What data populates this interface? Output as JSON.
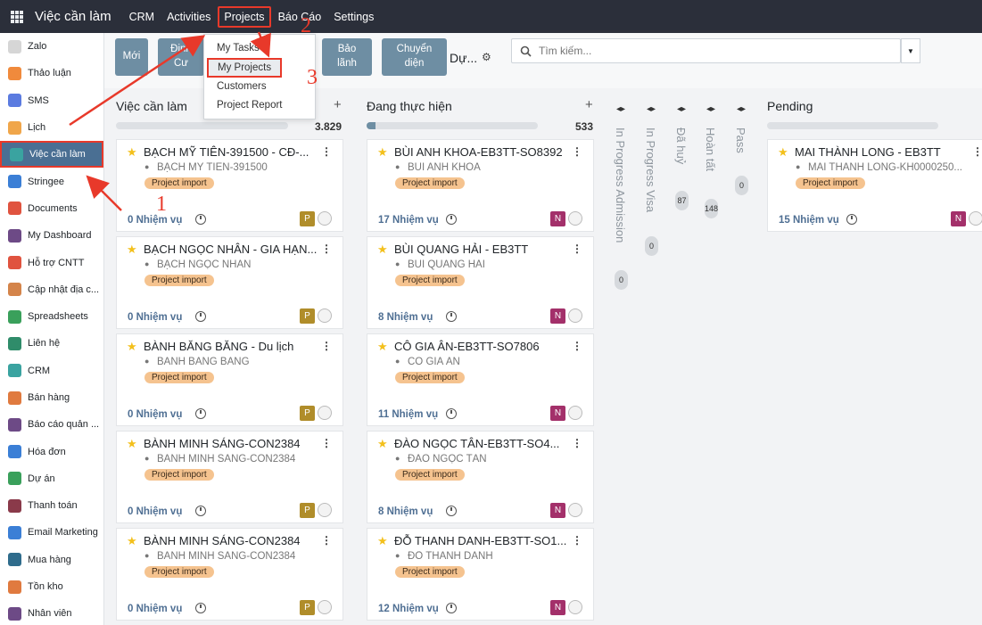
{
  "topbar": {
    "app_title": "Việc cần làm",
    "menu": [
      "CRM",
      "Activities",
      "Projects",
      "Báo Cáo",
      "Settings"
    ],
    "active_menu": "Projects"
  },
  "sidebar": {
    "items": [
      {
        "label": "Zalo",
        "icon": "zalo-icon",
        "color": "#d6d6d6"
      },
      {
        "label": "Thảo luận",
        "icon": "discuss-icon",
        "color": "#f08a3c"
      },
      {
        "label": "SMS",
        "icon": "sms-icon",
        "color": "#5b7be0"
      },
      {
        "label": "Lịch",
        "icon": "calendar-icon",
        "color": "#f0a64a"
      },
      {
        "label": "Việc cần làm",
        "icon": "todo-icon",
        "color": "#3aa3a0"
      },
      {
        "label": "Stringee",
        "icon": "stringee-icon",
        "color": "#3b7fd6"
      },
      {
        "label": "Documents",
        "icon": "documents-icon",
        "color": "#e0533f"
      },
      {
        "label": "My Dashboard",
        "icon": "dashboard-icon",
        "color": "#6d4a86"
      },
      {
        "label": "Hỗ trợ CNTT",
        "icon": "helpdesk-icon",
        "color": "#e0533f"
      },
      {
        "label": "Cập nhật địa c...",
        "icon": "map-icon",
        "color": "#d4844a"
      },
      {
        "label": "Spreadsheets",
        "icon": "spreadsheet-icon",
        "color": "#3aa05b"
      },
      {
        "label": "Liên hệ",
        "icon": "contacts-icon",
        "color": "#2f8c6a"
      },
      {
        "label": "CRM",
        "icon": "crm-icon",
        "color": "#3aa3a0"
      },
      {
        "label": "Bán hàng",
        "icon": "sales-icon",
        "color": "#e07a3f"
      },
      {
        "label": "Báo cáo quản ...",
        "icon": "report-icon",
        "color": "#6d4a86"
      },
      {
        "label": "Hóa đơn",
        "icon": "invoice-icon",
        "color": "#3b7fd6"
      },
      {
        "label": "Dự án",
        "icon": "project-icon",
        "color": "#3aa05b"
      },
      {
        "label": "Thanh toán",
        "icon": "payment-icon",
        "color": "#8a3a4a"
      },
      {
        "label": "Email Marketing",
        "icon": "email-icon",
        "color": "#3b7fd6"
      },
      {
        "label": "Mua hàng",
        "icon": "purchase-icon",
        "color": "#2f6c8c"
      },
      {
        "label": "Tồn kho",
        "icon": "inventory-icon",
        "color": "#e07a3f"
      },
      {
        "label": "Nhân viên",
        "icon": "employees-icon",
        "color": "#6d4a86"
      }
    ],
    "active_index": 4
  },
  "controls": {
    "new_button": "Mới",
    "dinh_cu_line1": "Định",
    "dinh_cu_line2": "Cư",
    "bao_lanh_line1": "Bảo",
    "bao_lanh_line2": "lãnh",
    "chuyen_dien_line1": "Chuyển",
    "chuyen_dien_line2": "diện",
    "view_label": "Dự...",
    "search_placeholder": "Tìm kiếm..."
  },
  "dropdown": {
    "items": [
      "My Tasks",
      "My Projects",
      "Customers",
      "Project Report"
    ],
    "selected": "My Projects"
  },
  "annotations": [
    "1",
    "2",
    "3"
  ],
  "colors": {
    "accent": "#6e8ea3",
    "highlight": "#e8392a",
    "tag_bg": "#f5c38f",
    "avatar_p": "#b08d2a",
    "avatar_n": "#a3306a"
  },
  "columns": [
    {
      "title": "Việc cần làm",
      "count": "3.829",
      "progress": 0.0,
      "cards": [
        {
          "title": "BẠCH MỸ TIÊN-391500 - CĐ-...",
          "customer": "BẠCH MỸ TIÊN-391500",
          "tag": "Project import",
          "tasks": "0 Nhiệm vụ",
          "avatar": "P"
        },
        {
          "title": "BẠCH NGỌC NHÂN - GIA HẠN...",
          "customer": "BẠCH NGỌC NHÂN",
          "tag": "Project import",
          "tasks": "0 Nhiệm vụ",
          "avatar": "P"
        },
        {
          "title": "BÀNH BĂNG BĂNG - Du lịch",
          "customer": "BÀNH BĂNG BĂNG",
          "tag": "Project import",
          "tasks": "0 Nhiệm vụ",
          "avatar": "P"
        },
        {
          "title": "BÀNH MINH SÁNG-CON2384",
          "customer": "BÀNH MINH SÁNG-CON2384",
          "tag": "Project import",
          "tasks": "0 Nhiệm vụ",
          "avatar": "P"
        },
        {
          "title": "BÀNH MINH SÁNG-CON2384",
          "customer": "BÀNH MINH SÁNG-CON2384",
          "tag": "Project import",
          "tasks": "0 Nhiệm vụ",
          "avatar": "P"
        }
      ]
    },
    {
      "title": "Đang thực hiện",
      "count": "533",
      "progress": 0.05,
      "cards": [
        {
          "title": "BÙI ANH KHOA-EB3TT-SO8392",
          "customer": "BÙI ANH KHOA",
          "tag": "Project import",
          "tasks": "17 Nhiệm vụ",
          "avatar": "N"
        },
        {
          "title": "BÙI QUANG HẢI - EB3TT",
          "customer": "BÙI QUANG HẢI",
          "tag": "Project import",
          "tasks": "8 Nhiệm vụ",
          "avatar": "N"
        },
        {
          "title": "CÔ GIA ÂN-EB3TT-SO7806",
          "customer": "CÔ GIA ÂN",
          "tag": "Project import",
          "tasks": "11 Nhiệm vụ",
          "avatar": "N"
        },
        {
          "title": "ĐÀO NGỌC TÂN-EB3TT-SO4...",
          "customer": "ĐÀO NGỌC TÂN",
          "tag": "Project import",
          "tasks": "8 Nhiệm vụ",
          "avatar": "N"
        },
        {
          "title": "ĐỖ THANH DANH-EB3TT-SO1...",
          "customer": "ĐỖ THANH DANH",
          "tag": "Project import",
          "tasks": "12 Nhiệm vụ",
          "avatar": "N"
        }
      ]
    },
    {
      "title": "Pending",
      "count": "",
      "progress": 0.0,
      "cards": [
        {
          "title": "MAI THÀNH LONG - EB3TT",
          "customer": "MAI THÀNH LONG-KH0000250...",
          "tag": "Project import",
          "tasks": "15 Nhiệm vụ",
          "avatar": "N"
        }
      ]
    }
  ],
  "folded_columns": [
    {
      "label": "In Progress Admission",
      "count": "0"
    },
    {
      "label": "In Progress Visa",
      "count": "0"
    },
    {
      "label": "Đã huỷ",
      "count": "87"
    },
    {
      "label": "Hoàn tất",
      "count": "148"
    },
    {
      "label": "Pass",
      "count": "0"
    }
  ]
}
